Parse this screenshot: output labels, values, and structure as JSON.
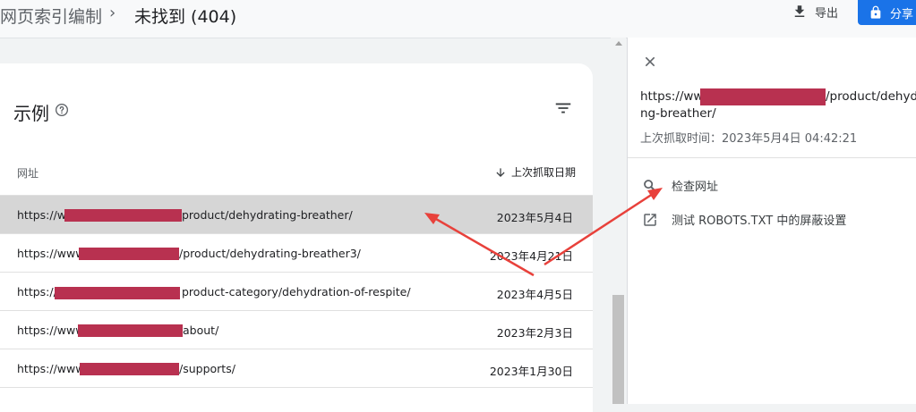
{
  "breadcrumb": {
    "root": "网页索引编制",
    "separator": "›",
    "current": "未找到 (404)"
  },
  "toolbar": {
    "export_label": "导出",
    "share_label": "分享"
  },
  "card": {
    "title": "示例",
    "column_url": "网址",
    "column_date": "上次抓取日期",
    "rows": [
      {
        "url_prefix": "https://w",
        "url_suffix": "product/dehydrating-breather/",
        "date": "2023年5月4日",
        "selected": true
      },
      {
        "url_prefix": "https://www",
        "url_suffix": "/product/dehydrating-breather3/",
        "date": "2023年4月21日",
        "selected": false
      },
      {
        "url_prefix": "https://",
        "url_suffix": "product-category/dehydration-of-respite/",
        "date": "2023年4月5日",
        "selected": false
      },
      {
        "url_prefix": "https://www",
        "url_suffix": "about/",
        "date": "2023年2月3日",
        "selected": false
      },
      {
        "url_prefix": "https://www",
        "url_suffix": "/supports/",
        "date": "2023年1月30日",
        "selected": false
      }
    ]
  },
  "panel": {
    "url_prefix": "https://ww",
    "url_line1_suffix": "/product/dehydrati",
    "url_line2": "ng-breather/",
    "last_crawl_label": "上次抓取时间：",
    "last_crawl_value": "2023年5月4日 04:42:21",
    "actions": [
      {
        "icon": "search-icon",
        "label": "检查网址"
      },
      {
        "icon": "open-external-icon",
        "label": "测试 ROBOTS.TXT 中的屏蔽设置"
      }
    ]
  },
  "colors": {
    "accent": "#1a73e8",
    "redaction": "#b83150",
    "annotation_arrow": "#e8413b",
    "selected_row": "#d6d6d6"
  }
}
